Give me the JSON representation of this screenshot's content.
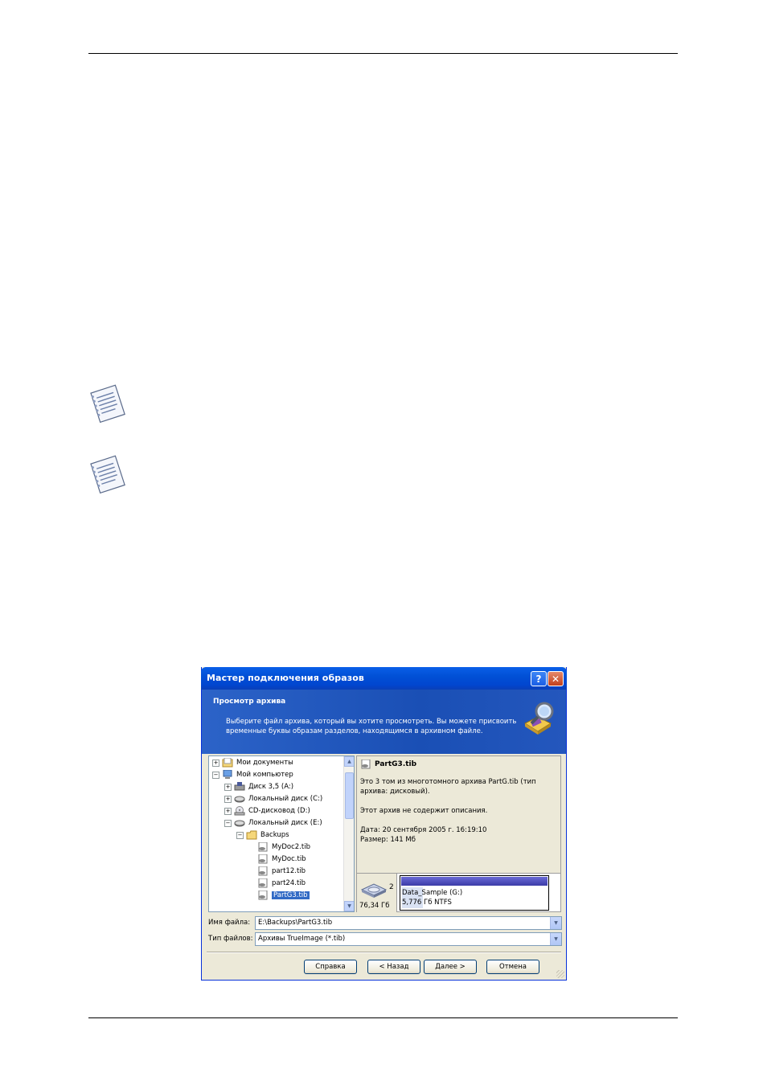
{
  "dialog": {
    "title": "Мастер подключения образов",
    "help_glyph": "?",
    "close_glyph": "✕",
    "header": {
      "title": "Просмотр архива",
      "description": "Выберите файл архива, который вы хотите просмотреть. Вы можете присвоить временные буквы образам разделов, находящимся в архивном файле."
    },
    "tree": [
      {
        "label": "Мои документы",
        "expander": "+",
        "icon": "documents-folder-icon"
      },
      {
        "label": "Мой компьютер",
        "expander": "−",
        "icon": "my-computer-icon"
      },
      {
        "label": "Диск 3,5 (A:)",
        "expander": "+",
        "icon": "floppy-drive-icon"
      },
      {
        "label": "Локальный диск (C:)",
        "expander": "+",
        "icon": "hard-drive-icon"
      },
      {
        "label": "CD-дисковод (D:)",
        "expander": "+",
        "icon": "cd-drive-icon"
      },
      {
        "label": "Локальный диск (E:)",
        "expander": "−",
        "icon": "hard-drive-icon"
      },
      {
        "label": "Backups",
        "expander": "−",
        "icon": "folder-icon"
      },
      {
        "label": "MyDoc2.tib",
        "expander": "",
        "icon": "archive-file-icon"
      },
      {
        "label": "MyDoc.tib",
        "expander": "",
        "icon": "archive-file-icon"
      },
      {
        "label": "part12.tib",
        "expander": "",
        "icon": "archive-file-icon"
      },
      {
        "label": "part24.tib",
        "expander": "",
        "icon": "archive-file-icon"
      },
      {
        "label": "PartG3.tib",
        "expander": "",
        "icon": "archive-file-icon",
        "selected": true
      }
    ],
    "info": {
      "file_name": "PartG3.tib",
      "volume_line1": "Это 3 том из многотомного архива PartG.tib (тип",
      "volume_line2": "архива: дисковый).",
      "no_description": "Этот архив не содержит описания.",
      "date": "Дата: 20 сентября 2005 г. 16:19:10",
      "size": "Размер: 141 Мб"
    },
    "disk": {
      "number": "2",
      "size": "76,34 Гб",
      "partition_name": "Data_Sample (G:)",
      "partition_info": "5,776 Гб  NTFS"
    },
    "filename_field": {
      "label": "Имя файла:",
      "value": "E:\\Backups\\PartG3.tib"
    },
    "filetype_field": {
      "label": "Тип файлов:",
      "value": "Архивы TrueImage (*.tib)"
    },
    "buttons": {
      "help": "Справка",
      "back": "< Назад",
      "next": "Далее >",
      "cancel": "Отмена"
    }
  }
}
